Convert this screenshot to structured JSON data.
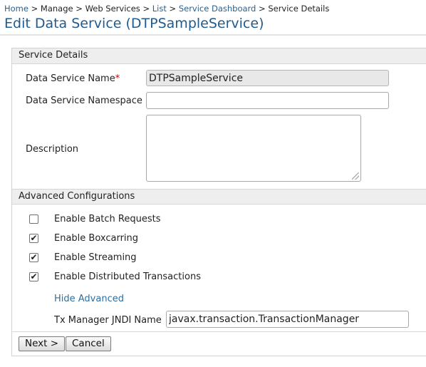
{
  "breadcrumb": {
    "home": "Home",
    "sep": ">",
    "manage": "Manage",
    "web_services": "Web Services",
    "list": "List",
    "service_dashboard": "Service Dashboard",
    "current": "Service Details"
  },
  "page_title": "Edit Data Service (DTPSampleService)",
  "service_details": {
    "header": "Service Details",
    "name_label": "Data Service Name",
    "required_mark": "*",
    "name_value": "DTPSampleService",
    "namespace_label": "Data Service Namespace",
    "namespace_value": "",
    "description_label": "Description",
    "description_value": ""
  },
  "advanced": {
    "header": "Advanced Configurations",
    "options": [
      {
        "label": "Enable Batch Requests",
        "checked": false
      },
      {
        "label": "Enable Boxcarring",
        "checked": true
      },
      {
        "label": "Enable Streaming",
        "checked": true
      },
      {
        "label": "Enable Distributed Transactions",
        "checked": true
      }
    ],
    "toggle_link": "Hide Advanced",
    "tx_label": "Tx Manager JNDI Name",
    "tx_value": "javax.transaction.TransactionManager"
  },
  "buttons": {
    "next": "Next >",
    "cancel": "Cancel"
  },
  "colors": {
    "title": "#1f5b8e",
    "link": "#2c6ea0",
    "section_bg": "#eeeeee",
    "required": "#cc0000"
  }
}
